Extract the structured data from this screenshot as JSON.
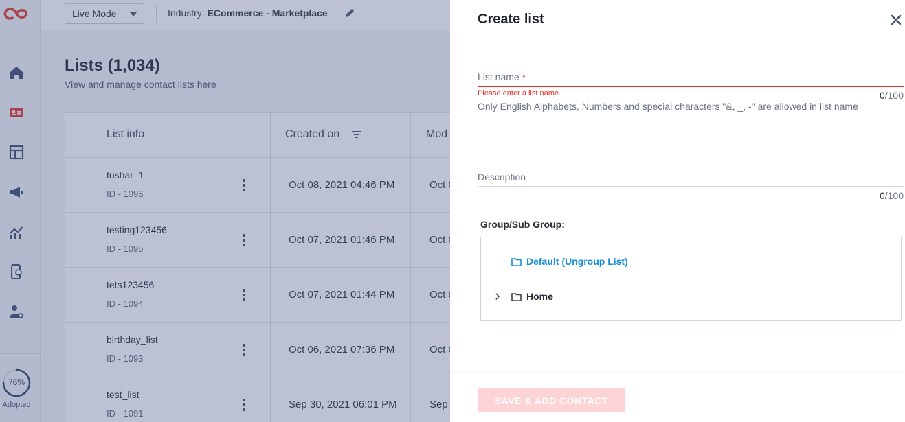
{
  "app": {
    "accent_color": "#e2342b",
    "link_color": "#1a8fd8"
  },
  "sidebar": {
    "icons": [
      "home-icon",
      "contacts-card-icon",
      "layout-icon",
      "megaphone-icon",
      "analytics-icon",
      "mobile-app-icon",
      "user-settings-icon"
    ],
    "adoption": {
      "percent_value": 76,
      "percent": "76%",
      "label": "Adopted"
    }
  },
  "topbar": {
    "mode": "Live Mode",
    "industry_label": "Industry:",
    "industry_value": "ECommerce - Marketplace"
  },
  "page": {
    "title": "Lists (1,034)",
    "subtitle": "View and manage contact lists here"
  },
  "table": {
    "columns": [
      "List info",
      "Created on",
      "Mod"
    ],
    "rows": [
      {
        "name": "tushar_1",
        "id": "ID - 1096",
        "created": "Oct 08, 2021 04:46 PM",
        "modified": "Oct 0"
      },
      {
        "name": "testing123456",
        "id": "ID - 1095",
        "created": "Oct 07, 2021 01:46 PM",
        "modified": "Oct 0"
      },
      {
        "name": "tets123456",
        "id": "ID - 1094",
        "created": "Oct 07, 2021 01:44 PM",
        "modified": "Oct 0"
      },
      {
        "name": "birthday_list",
        "id": "ID - 1093",
        "created": "Oct 06, 2021 07:36 PM",
        "modified": "Oct 0"
      },
      {
        "name": "test_list",
        "id": "ID - 1091",
        "created": "Sep 30, 2021 06:01 PM",
        "modified": "Sep"
      }
    ]
  },
  "drawer": {
    "title": "Create list",
    "list_name": {
      "label": "List name",
      "required_mark": "*",
      "value": "",
      "error": "Please enter a list name.",
      "count": "0",
      "max": "/100",
      "hint": "Only English Alphabets, Numbers and special characters \"&, _, -\" are allowed in list name"
    },
    "description": {
      "label": "Description",
      "value": "",
      "count": "0",
      "max": "/100"
    },
    "group": {
      "label": "Group/Sub Group:",
      "items": [
        "Default (Ungroup List)",
        "Home"
      ]
    },
    "save_button": "SAVE & ADD CONTACT"
  }
}
